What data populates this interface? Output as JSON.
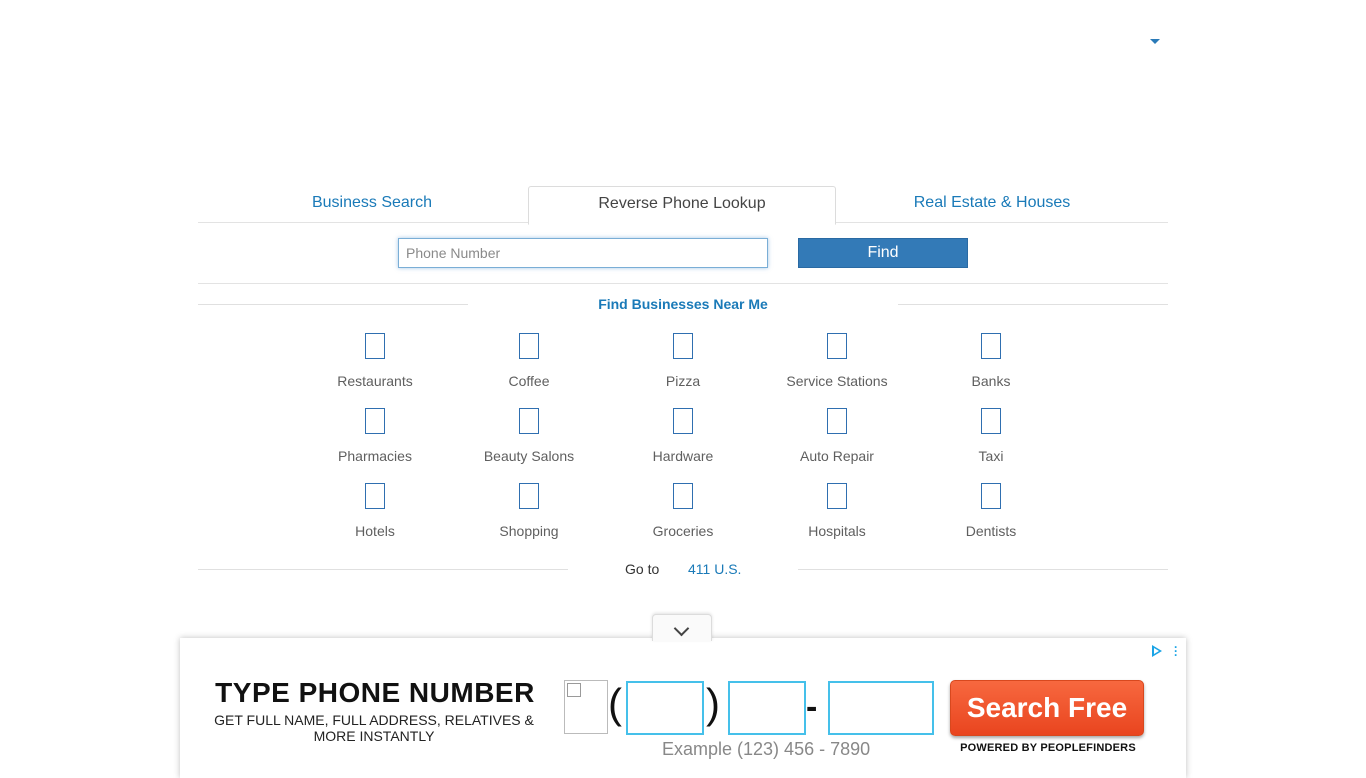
{
  "header": {
    "dropdown_icon": "caret-down-icon"
  },
  "tabs": [
    {
      "label": "Business Search",
      "active": false
    },
    {
      "label": "Reverse Phone Lookup",
      "active": true
    },
    {
      "label": "Real Estate & Houses",
      "active": false
    }
  ],
  "search": {
    "placeholder": "Phone Number",
    "button_label": "Find"
  },
  "near_me": {
    "title": "Find Businesses Near Me",
    "categories": [
      "Restaurants",
      "Coffee",
      "Pizza",
      "Service Stations",
      "Banks",
      "Pharmacies",
      "Beauty Salons",
      "Hardware",
      "Auto Repair",
      "Taxi",
      "Hotels",
      "Shopping",
      "Groceries",
      "Hospitals",
      "Dentists"
    ]
  },
  "goto": {
    "prefix": "Go to",
    "link": "411 U.S."
  },
  "ad": {
    "headline": "TYPE PHONE NUMBER",
    "subline": "GET FULL NAME, FULL ADDRESS, RELATIVES & MORE INSTANTLY",
    "open_paren": "(",
    "close_paren": ")",
    "dash": "-",
    "example": "Example (123) 456 - 7890",
    "button_label": "Search Free",
    "powered_by": "POWERED BY PEOPLEFINDERS",
    "accent_color": "#45c0ea",
    "button_color": "#f0552f"
  }
}
